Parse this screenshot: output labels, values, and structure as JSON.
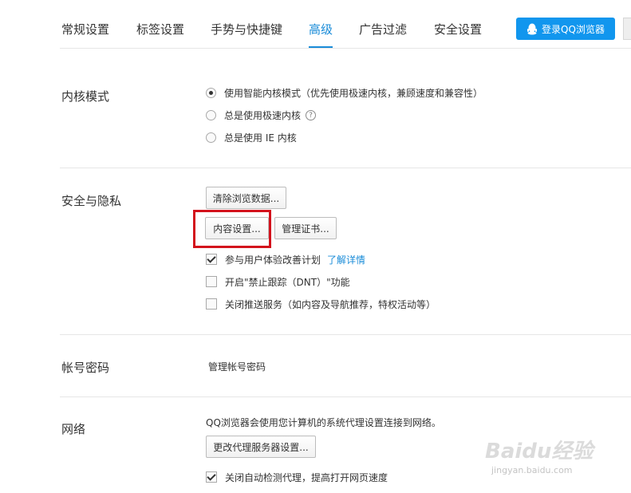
{
  "nav": {
    "tabs": [
      "常规设置",
      "标签设置",
      "手势与快捷键",
      "高级",
      "广告过滤",
      "安全设置"
    ],
    "active_tab": "高级",
    "login_label": "登录QQ浏览器"
  },
  "kernel": {
    "title": "内核模式",
    "options": [
      {
        "label": "使用智能内核模式（优先使用极速内核，兼顾速度和兼容性）",
        "selected": true
      },
      {
        "label": "总是使用极速内核",
        "selected": false,
        "help_icon": "?"
      },
      {
        "label": "总是使用 IE 内核",
        "selected": false
      }
    ]
  },
  "privacy": {
    "title": "安全与隐私",
    "clear_data_label": "清除浏览数据...",
    "content_settings_label": "内容设置...",
    "manage_certs_label": "管理证书...",
    "checks": [
      {
        "label": "参与用户体验改善计划",
        "checked": true,
        "link": "了解详情"
      },
      {
        "label": "开启\"禁止跟踪（DNT）\"功能",
        "checked": false
      },
      {
        "label": "关闭推送服务（如内容及导航推荐，特权活动等）",
        "checked": false
      }
    ]
  },
  "account": {
    "title": "帐号密码",
    "manage_link": "管理帐号密码"
  },
  "network": {
    "title": "网络",
    "description": "QQ浏览器会使用您计算机的系统代理设置连接到网络。",
    "proxy_button": "更改代理服务器设置...",
    "auto_detect_label": "关闭自动检测代理，提高打开网页速度",
    "auto_detect_checked": true
  },
  "watermark": {
    "main": "Baidu经验",
    "sub": "jingyan.baidu.com"
  },
  "colors": {
    "accent": "#1a8cd8",
    "login_button": "#1196ee",
    "highlight": "#d3121c"
  }
}
